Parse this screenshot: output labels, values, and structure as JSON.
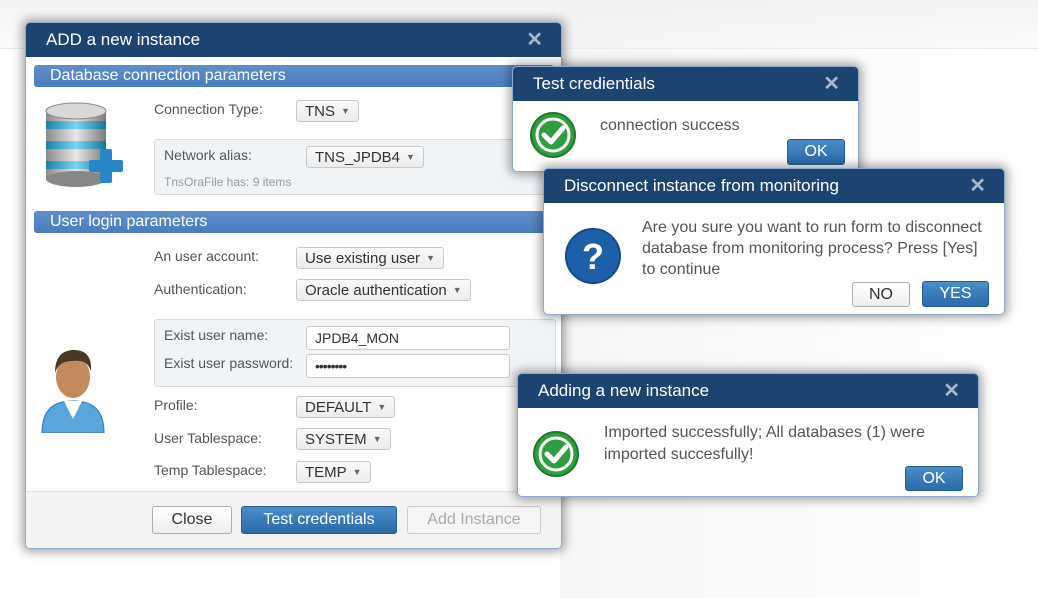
{
  "main_dialog": {
    "title": "ADD a new instance",
    "section_db": "Database connection parameters",
    "connection_type_label": "Connection Type:",
    "connection_type_value": "TNS",
    "network_alias_label": "Network alias:",
    "network_alias_value": "TNS_JPDB4",
    "tns_info": "TnsOraFile has: 9 items",
    "section_user": "User login parameters",
    "user_account_label": "An user account:",
    "user_account_value": "Use existing user",
    "authentication_label": "Authentication:",
    "authentication_value": "Oracle authentication",
    "exist_user_name_label": "Exist user name:",
    "exist_user_name_value": "JPDB4_MON",
    "exist_user_password_label": "Exist user password:",
    "exist_user_password_value": "••••••••",
    "profile_label": "Profile:",
    "profile_value": "DEFAULT",
    "user_tablespace_label": "User Tablespace:",
    "user_tablespace_value": "SYSTEM",
    "temp_tablespace_label": "Temp Tablespace:",
    "temp_tablespace_value": "TEMP",
    "close_button": "Close",
    "test_button": "Test credentials",
    "add_button": "Add Instance"
  },
  "test_dialog": {
    "title": "Test credientials",
    "message": "connection success",
    "ok_button": "OK"
  },
  "disconnect_dialog": {
    "title": "Disconnect instance from monitoring",
    "message": "Are you sure you want to run form to disconnect database from monitoring process? Press [Yes] to continue",
    "no_button": "NO",
    "yes_button": "YES"
  },
  "adding_dialog": {
    "title": "Adding a new instance",
    "message": "Imported successfully; All databases (1) were imported succesfully!",
    "ok_button": "OK"
  },
  "icons": {
    "close": "close-icon",
    "database_add": "database-add-icon",
    "user": "user-icon",
    "check": "check-circle-icon",
    "question": "question-circle-icon",
    "caret": "chevron-down-icon"
  },
  "colors": {
    "header": "#1d4471",
    "section": "#4a7cbf",
    "primary": "#2c6aa8",
    "success": "#2e9e3e",
    "question": "#1d5fa8"
  }
}
